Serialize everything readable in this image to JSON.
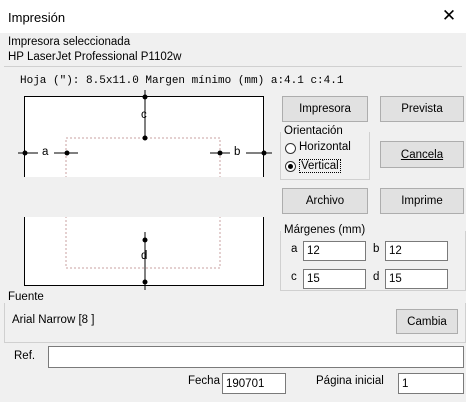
{
  "window": {
    "title": "Impresión"
  },
  "printer": {
    "label": "Impresora seleccionada",
    "name": "HP LaserJet Professional P1102w"
  },
  "page_info": "Hoja (\"): 8.5x11.0   Margen mínimo (mm) a:4.1 c:4.1",
  "preview": {
    "a": "a",
    "b": "b",
    "c": "c",
    "d": "d"
  },
  "buttons": {
    "printer": "Impresora",
    "preview": "Prevista",
    "cancel": "Cancela",
    "file": "Archivo",
    "print": "Imprime",
    "change_font": "Cambia"
  },
  "orientation": {
    "label": "Orientación",
    "horizontal": "Horizontal",
    "vertical": "Vertical",
    "selected": "vertical"
  },
  "margins": {
    "label": "Márgenes (mm)",
    "a_label": "a",
    "a": "12",
    "b_label": "b",
    "b": "12",
    "c_label": "c",
    "c": "15",
    "d_label": "d",
    "d": "15"
  },
  "font": {
    "label": "Fuente",
    "value": "Arial Narrow [8 ]"
  },
  "ref": {
    "label": "Ref.",
    "value": ""
  },
  "date": {
    "label": "Fecha",
    "value": "190701"
  },
  "start_page": {
    "label": "Página inicial",
    "value": "1"
  }
}
